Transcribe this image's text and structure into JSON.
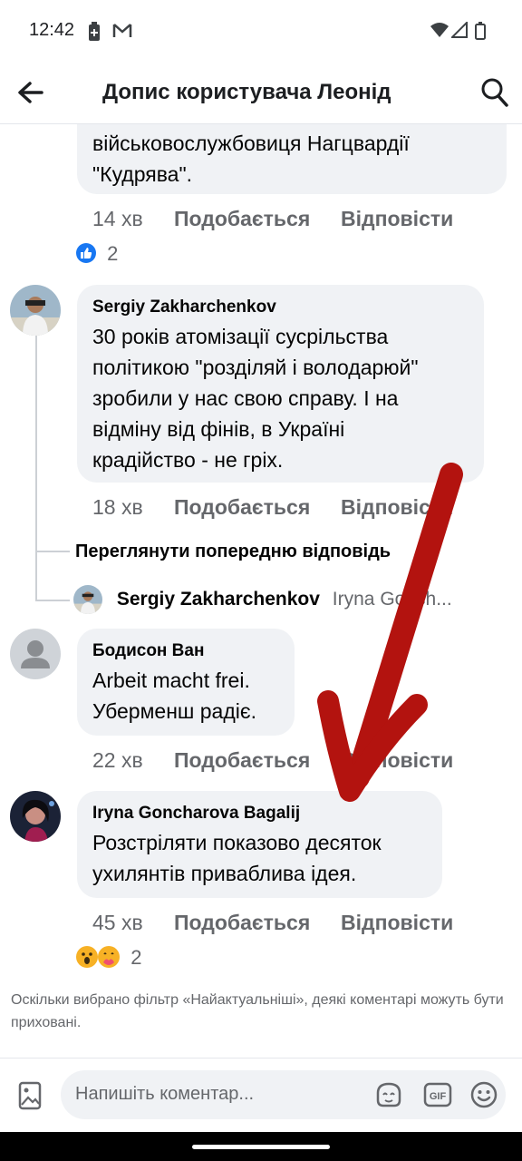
{
  "status": {
    "time": "12:42"
  },
  "header": {
    "title": "Допис користувача Леонід"
  },
  "comments": [
    {
      "text_lines": [
        "військовослужбовиця Нагцвардії",
        "\"Кудрява\"."
      ],
      "time": "14 хв",
      "like": "Подобається",
      "reply": "Відповісти",
      "reaction_count": "2"
    },
    {
      "author": "Sergiy  Zakharchenkov",
      "text_lines": [
        "30 років атомізації сусрільства",
        "політикою \"розділяй і володарюй\"",
        "зробили у нас свою справу. І на",
        "відміну від фінів, в Україні",
        "крадійство - не гріх."
      ],
      "time": "18 хв",
      "like": "Подобається",
      "reply": "Відповісти"
    },
    {
      "author": "Бодисон Ван",
      "text_lines": [
        "Arbeit macht frei.",
        "Уберменш радіє."
      ],
      "time": "22 хв",
      "like": "Подобається",
      "reply": "Відповісти"
    },
    {
      "author": "Iryna Goncharova Bagalij",
      "text_lines": [
        "Розстріляти показово десяток",
        "ухилянтів приваблива ідея."
      ],
      "time": "45 хв",
      "like": "Подобається",
      "reply": "Відповісти",
      "reaction_count": "2"
    }
  ],
  "replies": {
    "view_previous": "Переглянути попередню відповідь",
    "preview_author": "Sergiy  Zakharchenkov",
    "preview_text": "Iryna Gonch..."
  },
  "notice": "Оскільки вибрано фільтр «Найактуальніші», деякі коментарі можуть бути приховані.",
  "composer": {
    "placeholder": "Напишіть коментар..."
  },
  "colors": {
    "accent": "#1877f2",
    "bubble": "#f0f2f5",
    "annotation_arrow": "#b3130f"
  }
}
